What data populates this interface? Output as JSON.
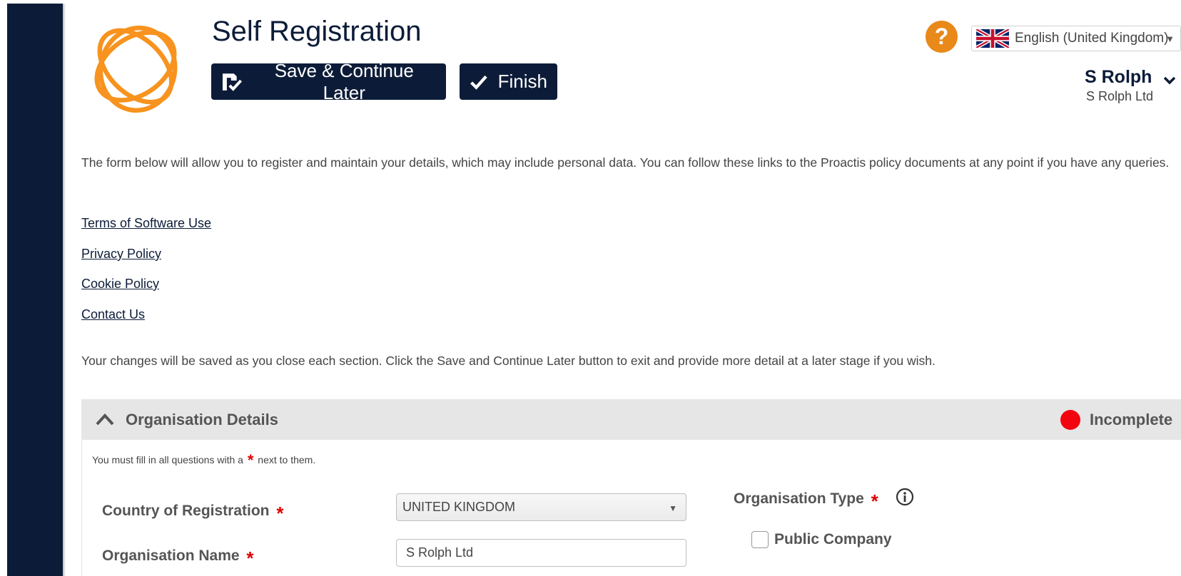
{
  "header": {
    "title": "Self Registration",
    "save_label": "Save & Continue Later",
    "finish_label": "Finish",
    "help_glyph": "?",
    "language": "English (United Kingdom)",
    "user": {
      "name": "S Rolph",
      "organisation": "S Rolph Ltd"
    }
  },
  "intro": {
    "text": "The form below will allow you to register and maintain your details, which may include personal data. You can follow these links to the Proactis policy documents at any point if you have any queries."
  },
  "links": {
    "terms": "Terms of Software Use",
    "privacy": "Privacy Policy",
    "cookie": "Cookie Policy",
    "contact": "Contact Us"
  },
  "save_note": "Your changes will be saved as you close each section. Click the Save and Continue Later button to exit and provide more detail at a later stage if you wish.",
  "section": {
    "title": "Organisation Details",
    "status": "Incomplete",
    "required_note_before": "You must fill in all questions with a",
    "required_star": "*",
    "required_note_after": "next to them.",
    "fields": {
      "country_label": "Country of Registration",
      "country_value": "UNITED KINGDOM",
      "orgname_label": "Organisation Name",
      "orgname_value": "S Rolph Ltd",
      "orgtype_label": "Organisation Type",
      "orgtype_option": "Public Company"
    }
  },
  "colors": {
    "navy": "#0c1c38",
    "accent_orange": "#f7931e",
    "help_orange": "#e8891a",
    "status_red": "#f2050f",
    "required_red": "#e00000"
  },
  "icons": {
    "logo": "orange-rings-logo",
    "save": "floppy-check-icon",
    "finish": "checkmark-icon",
    "help": "question-icon",
    "flag": "uk-flag-icon",
    "user_menu": "chevron-down-icon",
    "section_toggle": "chevron-up-icon",
    "info": "info-icon"
  }
}
